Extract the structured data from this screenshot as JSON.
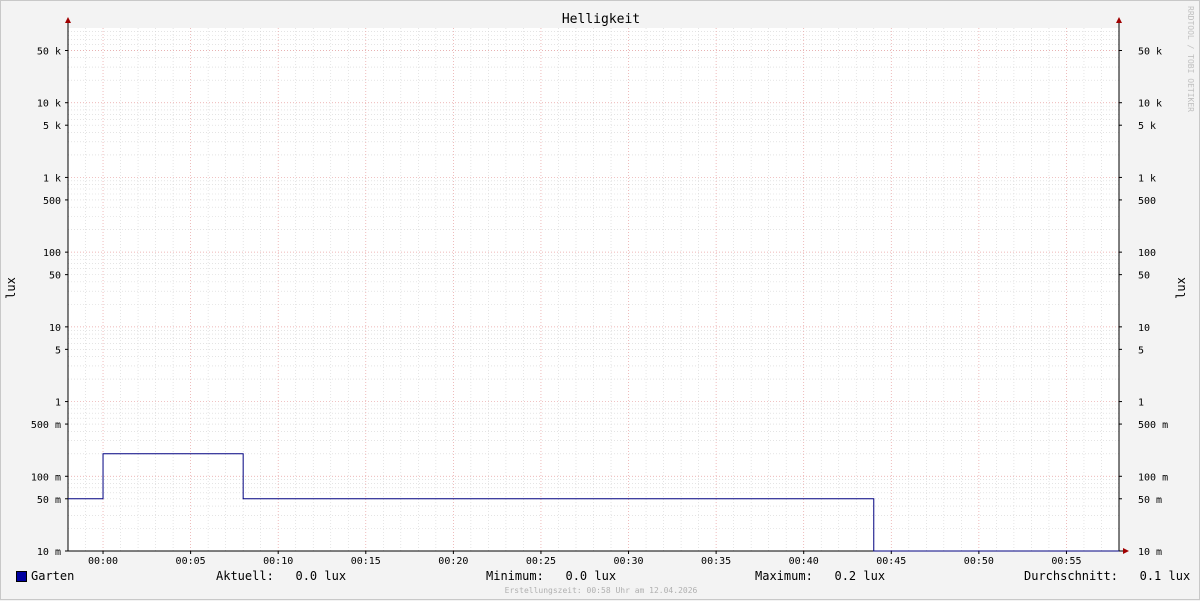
{
  "chart_data": {
    "type": "line",
    "title": "Helligkeit",
    "ylabel": "lux",
    "yscale": "log",
    "ylim": [
      0.01,
      100000
    ],
    "y_ticks": [
      {
        "value": 50000,
        "label": "50 k",
        "major": true
      },
      {
        "value": 10000,
        "label": "10 k",
        "major": true
      },
      {
        "value": 5000,
        "label": "5 k",
        "major": false
      },
      {
        "value": 1000,
        "label": "1 k",
        "major": true
      },
      {
        "value": 500,
        "label": "500",
        "major": false
      },
      {
        "value": 100,
        "label": "100",
        "major": true
      },
      {
        "value": 50,
        "label": "50",
        "major": false
      },
      {
        "value": 10,
        "label": "10",
        "major": true
      },
      {
        "value": 5,
        "label": "5",
        "major": false
      },
      {
        "value": 1,
        "label": "1",
        "major": true
      },
      {
        "value": 0.5,
        "label": "500 m",
        "major": false
      },
      {
        "value": 0.1,
        "label": "100 m",
        "major": true
      },
      {
        "value": 0.05,
        "label": "50 m",
        "major": false
      },
      {
        "value": 0.01,
        "label": "10 m",
        "major": true
      }
    ],
    "xlim_minutes": [
      -2,
      58
    ],
    "x_ticks": [
      {
        "minute": 0,
        "label": "00:00"
      },
      {
        "minute": 5,
        "label": "00:05"
      },
      {
        "minute": 10,
        "label": "00:10"
      },
      {
        "minute": 15,
        "label": "00:15"
      },
      {
        "minute": 20,
        "label": "00:20"
      },
      {
        "minute": 25,
        "label": "00:25"
      },
      {
        "minute": 30,
        "label": "00:30"
      },
      {
        "minute": 35,
        "label": "00:35"
      },
      {
        "minute": 40,
        "label": "00:40"
      },
      {
        "minute": 45,
        "label": "00:45"
      },
      {
        "minute": 50,
        "label": "00:50"
      },
      {
        "minute": 55,
        "label": "00:55"
      }
    ],
    "grid": true,
    "series": [
      {
        "name": "Garten",
        "color": "#000080",
        "step": true,
        "points": [
          {
            "minute": -2,
            "value": 0.05
          },
          {
            "minute": 0,
            "value": 0.2
          },
          {
            "minute": 8,
            "value": 0.05
          },
          {
            "minute": 44,
            "value": 0.01
          },
          {
            "minute": 58,
            "value": 0.01
          }
        ]
      }
    ]
  },
  "legend": {
    "series_name": "Garten",
    "swatch_color": "#0000a0",
    "aktuell": "Aktuell:   0.0 lux",
    "minimum": "Minimum:   0.0 lux",
    "maximum": "Maximum:   0.2 lux",
    "durchschnitt": "Durchschnitt:   0.1 lux"
  },
  "footer": "Erstellungszeit: 00:58 Uhr am 12.04.2026",
  "watermark": "RRDTOOL / TOBI OETIKER"
}
